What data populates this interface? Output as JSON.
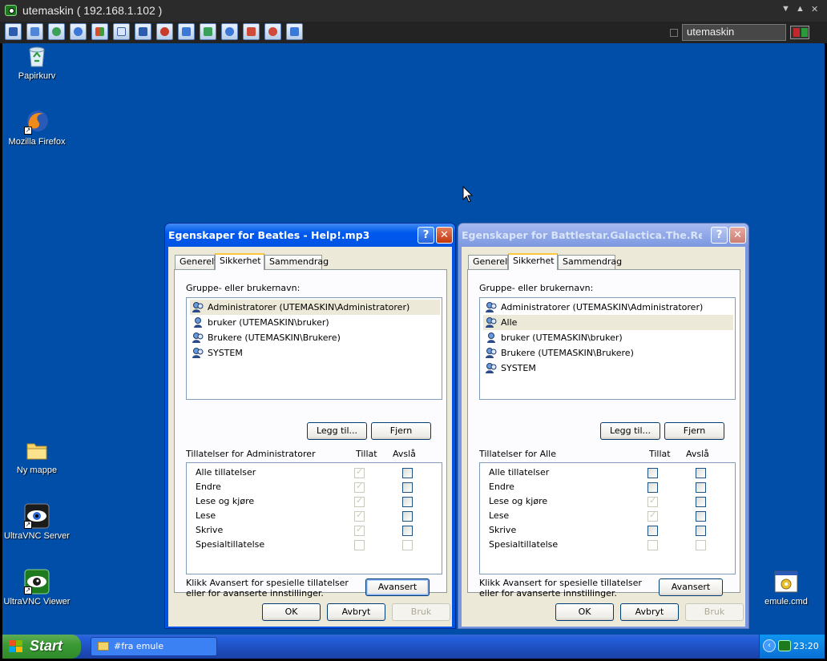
{
  "vnc": {
    "title": "utemaskin ( 192.168.1.102 )",
    "connection_name": "utemaskin",
    "window_controls": [
      "▼",
      "▲",
      "✕"
    ]
  },
  "desktop_icons": [
    {
      "id": "recycle",
      "label": "Papirkurv"
    },
    {
      "id": "firefox",
      "label": "Mozilla Firefox"
    },
    {
      "id": "folder",
      "label": "Ny mappe"
    },
    {
      "id": "uvnc-server",
      "label": "UltraVNC Server"
    },
    {
      "id": "uvnc-viewer",
      "label": "UltraVNC Viewer"
    },
    {
      "id": "emule",
      "label": "emule.cmd"
    }
  ],
  "dialog1": {
    "title": "Egenskaper for Beatles - Help!.mp3",
    "tabs": [
      "Generelt",
      "Sikkerhet",
      "Sammendrag"
    ],
    "group_label": "Gruppe- eller brukernavn:",
    "users": [
      "Administratorer (UTEMASKIN\\Administratorer)",
      "bruker (UTEMASKIN\\bruker)",
      "Brukere (UTEMASKIN\\Brukere)",
      "SYSTEM"
    ],
    "add_label": "Legg til...",
    "remove_label": "Fjern",
    "perm_label": "Tillatelser for Administratorer",
    "allow_header": "Tillat",
    "deny_header": "Avslå",
    "permissions": [
      "Alle tillatelser",
      "Endre",
      "Lese og kjøre",
      "Lese",
      "Skrive",
      "Spesialtillatelse"
    ],
    "note": "Klikk Avansert for spesielle tillatelser eller for avanserte innstillinger.",
    "advanced_label": "Avansert",
    "ok_label": "OK",
    "cancel_label": "Avbryt",
    "apply_label": "Bruk"
  },
  "dialog2": {
    "title": "Egenskaper for Battlestar.Galactica.The.Resist...",
    "tabs": [
      "Generelt",
      "Sikkerhet",
      "Sammendrag"
    ],
    "group_label": "Gruppe- eller brukernavn:",
    "users": [
      "Administratorer (UTEMASKIN\\Administratorer)",
      "Alle",
      "bruker (UTEMASKIN\\bruker)",
      "Brukere (UTEMASKIN\\Brukere)",
      "SYSTEM"
    ],
    "add_label": "Legg til...",
    "remove_label": "Fjern",
    "perm_label": "Tillatelser for Alle",
    "allow_header": "Tillat",
    "deny_header": "Avslå",
    "permissions": [
      "Alle tillatelser",
      "Endre",
      "Lese og kjøre",
      "Lese",
      "Skrive",
      "Spesialtillatelse"
    ],
    "note": "Klikk Avansert for spesielle tillatelser eller for avanserte innstillinger.",
    "advanced_label": "Avansert",
    "ok_label": "OK",
    "cancel_label": "Avbryt",
    "apply_label": "Bruk"
  },
  "taskbar": {
    "start_label": "Start",
    "task_item": "#fra emule",
    "clock": "23:20"
  }
}
